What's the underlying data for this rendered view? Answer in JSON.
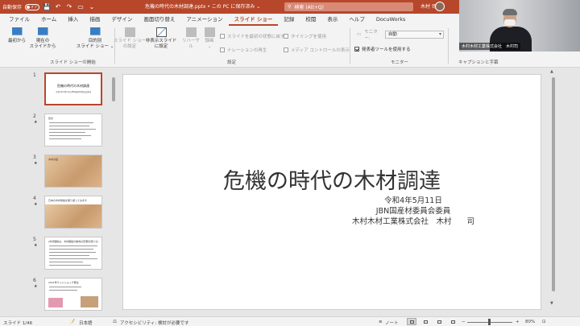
{
  "titlebar": {
    "autosave_label": "自動保存",
    "autosave_state": "オフ",
    "doc_title": "危機の時代の木材調達.pptx • この PC に保存済み ⌄",
    "search_placeholder": "検索 (Alt+Q)",
    "user_name": "木村 司"
  },
  "tabs": [
    "ファイル",
    "ホーム",
    "挿入",
    "描画",
    "デザイン",
    "画面切り替え",
    "アニメーション",
    "スライド ショー",
    "記録",
    "校閲",
    "表示",
    "ヘルプ",
    "DocuWorks"
  ],
  "active_tab": "スライド ショー",
  "ribbon": {
    "from_start": "最初から",
    "from_current": "現在の\nスライドから",
    "custom_show": "目的別\nスライド ショー ⌄",
    "group_start": "スライド ショーの開始",
    "setup_show": "スライド ショー\nの設定",
    "hide_slide": "非表示スライド\nに設定",
    "rehearse": "リハーサル",
    "record": "録画\n⌄",
    "chk_record_start": "スライドを最初の状態に戻す",
    "chk_narration": "ナレーションの再生",
    "chk_timing": "タイミングを使用",
    "chk_media": "メディア コントロールの表示",
    "group_setup": "設定",
    "monitor_label": "モニター:",
    "monitor_value": "自動",
    "chk_presenter": "発表者ツールを使用する",
    "group_monitor": "モニター",
    "group_captions": "キャプションと字幕"
  },
  "webcam": {
    "label": "木村木材工業株式会社　木村司"
  },
  "thumbnails": [
    {
      "num": "1",
      "star": "",
      "title": "危機の時代の木材調達",
      "sub": "令和4年5月11日 JBN国産材委員会委員"
    },
    {
      "num": "2",
      "star": "★",
      "title": "目次",
      "sub": ""
    },
    {
      "num": "3",
      "star": "★",
      "title": "木材の話",
      "sub": ""
    },
    {
      "num": "4",
      "star": "★",
      "title": "日本の木材供給を振り返ってみます",
      "sub": ""
    },
    {
      "num": "5",
      "star": "★",
      "title": "(木材価格は、木材需給の動向の影響を受ける)",
      "sub": ""
    },
    {
      "num": "6",
      "star": "★",
      "title": "2021年ウッドショック発生",
      "sub": ""
    }
  ],
  "slide": {
    "title": "危機の時代の木材調達",
    "date": "令和4年5月11日",
    "line2": "JBN国産材委員会委員",
    "line3": "木村木材工業株式会社　木村　　司"
  },
  "statusbar": {
    "slide_info": "スライド 1/46",
    "language": "日本語",
    "accessibility": "アクセシビリティ: 検討が必要です",
    "notes": "ノート",
    "zoom": "80%",
    "zoom_minus": "−",
    "zoom_plus": "+"
  },
  "colors": {
    "accent": "#b7472a",
    "ribbon_bg": "#f3f3f3",
    "canvas_bg": "#e6e6e6"
  }
}
